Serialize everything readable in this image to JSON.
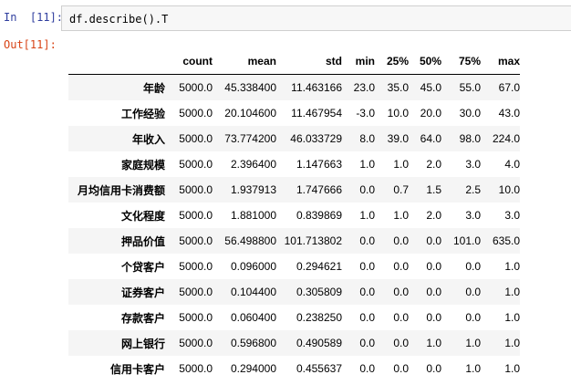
{
  "cell_in": {
    "prompt": "In  [11]:",
    "code": "df.describe().T"
  },
  "cell_out": {
    "prompt": "Out[11]:"
  },
  "table": {
    "columns": [
      "count",
      "mean",
      "std",
      "min",
      "25%",
      "50%",
      "75%",
      "max"
    ],
    "rows": [
      {
        "index": "年龄",
        "values": [
          "5000.0",
          "45.338400",
          "11.463166",
          "23.0",
          "35.0",
          "45.0",
          "55.0",
          "67.0"
        ]
      },
      {
        "index": "工作经验",
        "values": [
          "5000.0",
          "20.104600",
          "11.467954",
          "-3.0",
          "10.0",
          "20.0",
          "30.0",
          "43.0"
        ]
      },
      {
        "index": "年收入",
        "values": [
          "5000.0",
          "73.774200",
          "46.033729",
          "8.0",
          "39.0",
          "64.0",
          "98.0",
          "224.0"
        ]
      },
      {
        "index": "家庭规模",
        "values": [
          "5000.0",
          "2.396400",
          "1.147663",
          "1.0",
          "1.0",
          "2.0",
          "3.0",
          "4.0"
        ]
      },
      {
        "index": "月均信用卡消费额",
        "values": [
          "5000.0",
          "1.937913",
          "1.747666",
          "0.0",
          "0.7",
          "1.5",
          "2.5",
          "10.0"
        ]
      },
      {
        "index": "文化程度",
        "values": [
          "5000.0",
          "1.881000",
          "0.839869",
          "1.0",
          "1.0",
          "2.0",
          "3.0",
          "3.0"
        ]
      },
      {
        "index": "押品价值",
        "values": [
          "5000.0",
          "56.498800",
          "101.713802",
          "0.0",
          "0.0",
          "0.0",
          "101.0",
          "635.0"
        ]
      },
      {
        "index": "个贷客户",
        "values": [
          "5000.0",
          "0.096000",
          "0.294621",
          "0.0",
          "0.0",
          "0.0",
          "0.0",
          "1.0"
        ]
      },
      {
        "index": "证券客户",
        "values": [
          "5000.0",
          "0.104400",
          "0.305809",
          "0.0",
          "0.0",
          "0.0",
          "0.0",
          "1.0"
        ]
      },
      {
        "index": "存款客户",
        "values": [
          "5000.0",
          "0.060400",
          "0.238250",
          "0.0",
          "0.0",
          "0.0",
          "0.0",
          "1.0"
        ]
      },
      {
        "index": "网上银行",
        "values": [
          "5000.0",
          "0.596800",
          "0.490589",
          "0.0",
          "0.0",
          "1.0",
          "1.0",
          "1.0"
        ]
      },
      {
        "index": "信用卡客户",
        "values": [
          "5000.0",
          "0.294000",
          "0.455637",
          "0.0",
          "0.0",
          "0.0",
          "1.0",
          "1.0"
        ]
      }
    ]
  }
}
